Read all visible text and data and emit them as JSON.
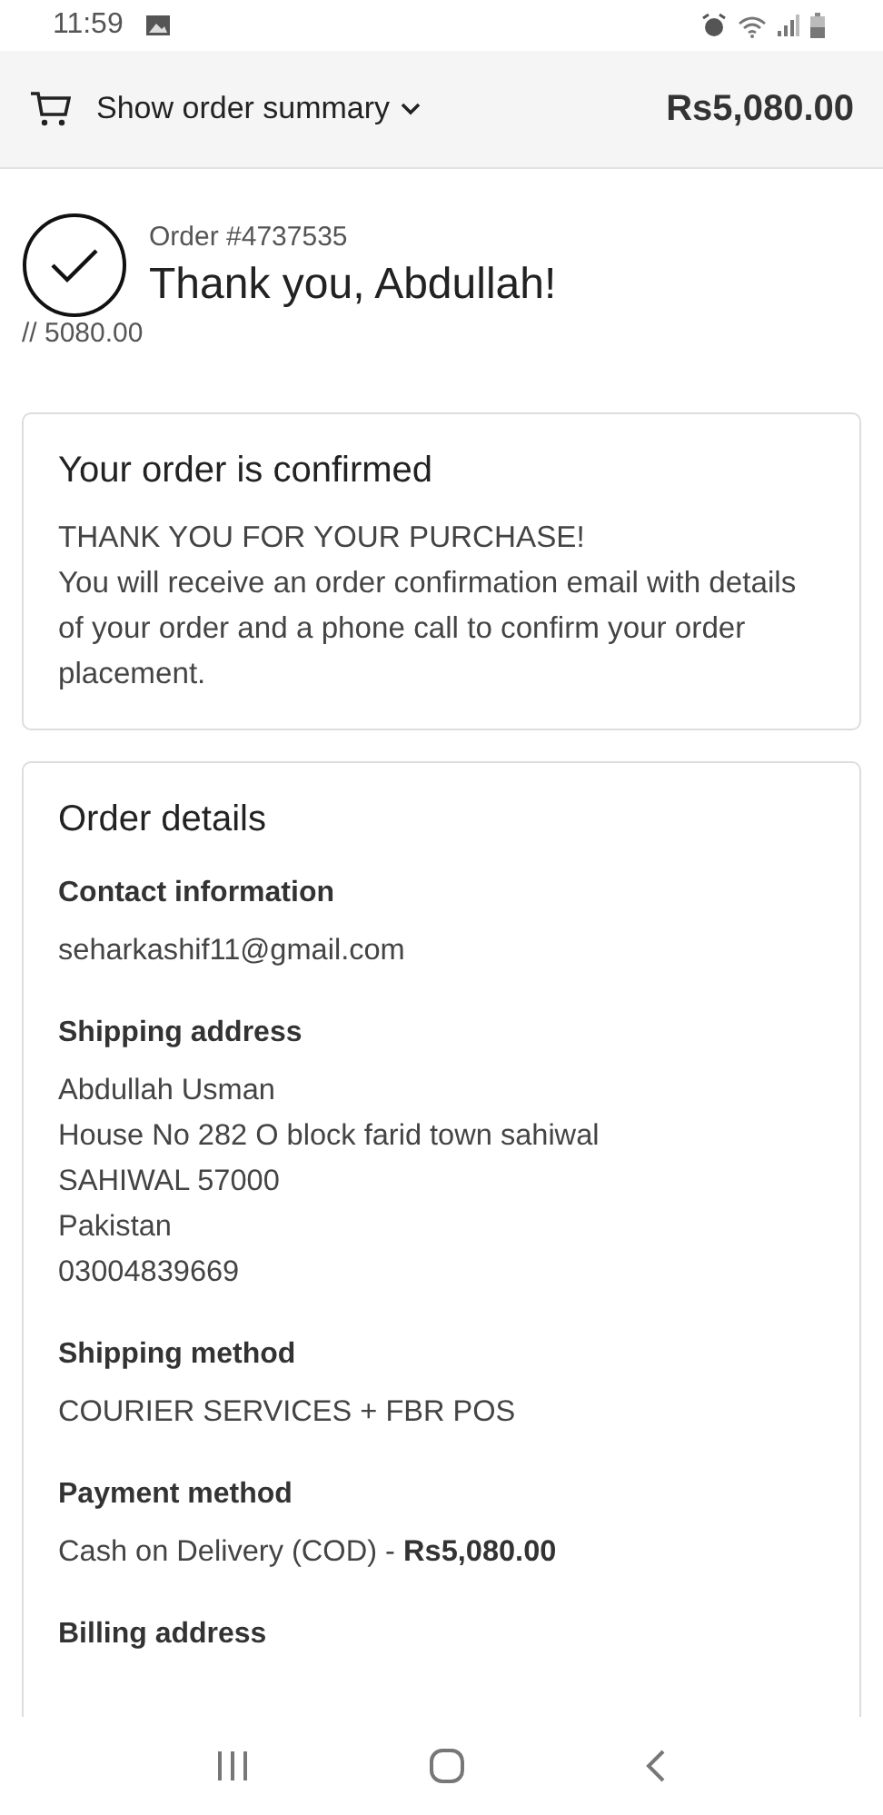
{
  "status_bar": {
    "time": "11:59"
  },
  "header": {
    "toggle_label": "Show order summary",
    "total": "Rs5,080.00"
  },
  "order": {
    "number": "Order #4737535",
    "greeting": "Thank you, Abdullah!",
    "note": "// 5080.00"
  },
  "confirmation": {
    "title": "Your order is confirmed",
    "lines": [
      "THANK YOU FOR YOUR PURCHASE!",
      "You will receive an order confirmation email with details of your order and a phone call to confirm your order placement."
    ]
  },
  "details": {
    "title": "Order details",
    "sections": [
      {
        "heading": "Contact information",
        "lines": [
          "seharkashif11@gmail.com"
        ]
      },
      {
        "heading": "Shipping address",
        "lines": [
          "Abdullah Usman",
          "House No 282 O block farid town sahiwal",
          "SAHIWAL 57000",
          "Pakistan",
          "03004839669"
        ]
      },
      {
        "heading": "Shipping method",
        "lines": [
          "COURIER SERVICES + FBR POS"
        ]
      },
      {
        "heading": "Payment method",
        "lines": [
          "Cash on Delivery (COD) - **Rs5,080.00**"
        ]
      },
      {
        "heading": "Billing address"
      }
    ]
  }
}
